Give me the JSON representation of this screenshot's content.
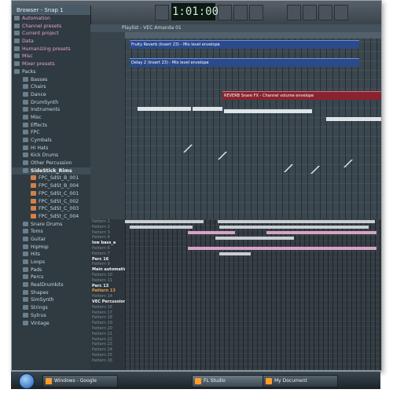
{
  "window": {
    "clock": "1:01:000"
  },
  "browser": {
    "title": "Browser - Snap 1",
    "items": [
      {
        "label": "Automation",
        "style": "top"
      },
      {
        "label": "Channel presets",
        "style": "top"
      },
      {
        "label": "Current project",
        "style": "top"
      },
      {
        "label": "Data",
        "style": "top"
      },
      {
        "label": "Humanizing presets",
        "style": "top"
      },
      {
        "label": "Misc",
        "style": "top"
      },
      {
        "label": "Mixer presets",
        "style": "top"
      },
      {
        "label": "Packs",
        "style": ""
      },
      {
        "label": "Basses",
        "style": ""
      },
      {
        "label": "Chairs",
        "style": ""
      },
      {
        "label": "Dance",
        "style": ""
      },
      {
        "label": "DrumSynth",
        "style": ""
      },
      {
        "label": "Instruments",
        "style": ""
      },
      {
        "label": "Misc",
        "style": ""
      },
      {
        "label": "Effects",
        "style": ""
      },
      {
        "label": "FPC",
        "style": ""
      },
      {
        "label": "Cymbals",
        "style": ""
      },
      {
        "label": "Hi Hats",
        "style": ""
      },
      {
        "label": "Kick Drums",
        "style": ""
      },
      {
        "label": "Other Percussion",
        "style": ""
      },
      {
        "label": "SideStick_Rims",
        "style": "sel"
      },
      {
        "label": "FPC_SdSt_B_001",
        "style": "file"
      },
      {
        "label": "FPC_SdSt_B_004",
        "style": "file"
      },
      {
        "label": "FPC_SdSt_C_001",
        "style": "file"
      },
      {
        "label": "FPC_SdSt_C_002",
        "style": "file"
      },
      {
        "label": "FPC_SdSt_C_003",
        "style": "file"
      },
      {
        "label": "FPC_SdSt_C_004",
        "style": "file"
      },
      {
        "label": "Snare Drums",
        "style": ""
      },
      {
        "label": "Toms",
        "style": ""
      },
      {
        "label": "Guitar",
        "style": ""
      },
      {
        "label": "HipHop",
        "style": ""
      },
      {
        "label": "Hits",
        "style": ""
      },
      {
        "label": "Loops",
        "style": ""
      },
      {
        "label": "Pads",
        "style": ""
      },
      {
        "label": "Percs",
        "style": ""
      },
      {
        "label": "RealDrumkits",
        "style": ""
      },
      {
        "label": "Shapes",
        "style": ""
      },
      {
        "label": "SimSynth",
        "style": ""
      },
      {
        "label": "Strings",
        "style": ""
      },
      {
        "label": "Sytrus",
        "style": ""
      },
      {
        "label": "Vintage",
        "style": ""
      }
    ]
  },
  "playlist": {
    "title": "Playlist - VEC Amanda 01",
    "clips": [
      {
        "label": "Fruity Reverb (Insert 23) - Mix level envelope",
        "kind": "blue"
      },
      {
        "label": "Delay 2 (Insert 23) - Mix level envelope",
        "kind": "blue"
      },
      {
        "label": "REVERB Snare FX - Channel volume envelope",
        "kind": "red"
      }
    ],
    "patterns": [
      {
        "label": "Pattern 1",
        "style": ""
      },
      {
        "label": "Pattern 2",
        "style": ""
      },
      {
        "label": "Pattern 3",
        "style": ""
      },
      {
        "label": "Pattern 4",
        "style": ""
      },
      {
        "label": "low bass_a",
        "style": "w"
      },
      {
        "label": "Pattern 6",
        "style": ""
      },
      {
        "label": "Pattern 7",
        "style": ""
      },
      {
        "label": "Perc 16",
        "style": "w"
      },
      {
        "label": "Pattern 9",
        "style": ""
      },
      {
        "label": "Main automation",
        "style": "w"
      },
      {
        "label": "Pattern 10",
        "style": ""
      },
      {
        "label": "Pattern 11",
        "style": ""
      },
      {
        "label": "Perc 13",
        "style": "w"
      },
      {
        "label": "Pattern 13",
        "style": "o"
      },
      {
        "label": "Pattern 14",
        "style": ""
      },
      {
        "label": "VEC Percussion...",
        "style": "w"
      },
      {
        "label": "Pattern 16",
        "style": ""
      },
      {
        "label": "Pattern 17",
        "style": ""
      },
      {
        "label": "Pattern 18",
        "style": ""
      },
      {
        "label": "Pattern 19",
        "style": ""
      },
      {
        "label": "Pattern 20",
        "style": ""
      },
      {
        "label": "Pattern 21",
        "style": ""
      },
      {
        "label": "Pattern 22",
        "style": ""
      },
      {
        "label": "Pattern 23",
        "style": ""
      },
      {
        "label": "Pattern 24",
        "style": ""
      },
      {
        "label": "Pattern 25",
        "style": ""
      },
      {
        "label": "Pattern 26",
        "style": ""
      }
    ]
  },
  "taskbar": {
    "tasks": [
      {
        "label": "Windows - Google",
        "active": false
      },
      {
        "label": "FL Studio",
        "active": true
      },
      {
        "label": "My Document",
        "active": false
      }
    ]
  }
}
